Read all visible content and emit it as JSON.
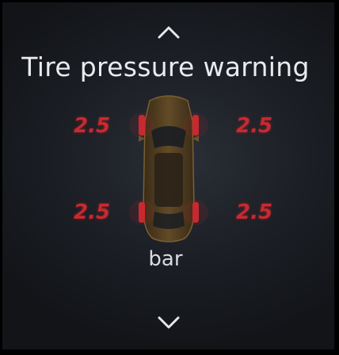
{
  "nav": {
    "up_icon": "chevron-up-icon",
    "down_icon": "chevron-down-icon"
  },
  "title": "Tire pressure warning",
  "tires": {
    "front_left": "2.5",
    "front_right": "2.5",
    "rear_left": "2.5",
    "rear_right": "2.5"
  },
  "unit": "bar",
  "colors": {
    "warning": "#c9292f",
    "text": "#e9ebee",
    "background": "#1b1e24",
    "car_body": "#7a5a28"
  }
}
